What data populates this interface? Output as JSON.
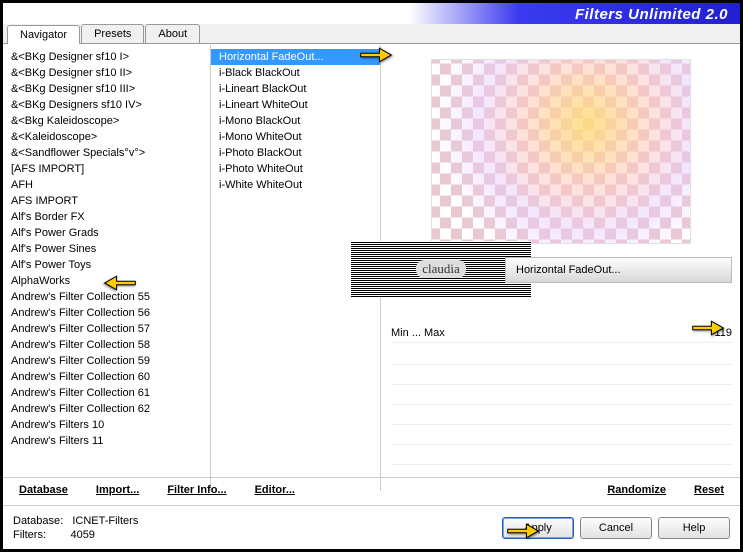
{
  "header": {
    "title": "Filters Unlimited 2.0"
  },
  "tabs": [
    "Navigator",
    "Presets",
    "About"
  ],
  "active_tab": 0,
  "categories": [
    "&<BKg Designer sf10 I>",
    "&<BKg Designer sf10 II>",
    "&<BKg Designer sf10 III>",
    "&<BKg Designers sf10 IV>",
    "&<Bkg Kaleidoscope>",
    "&<Kaleidoscope>",
    "&<Sandflower Specials°v°>",
    "[AFS IMPORT]",
    "AFH",
    "AFS IMPORT",
    "Alf's Border FX",
    "Alf's Power Grads",
    "Alf's Power Sines",
    "Alf's Power Toys",
    "AlphaWorks",
    "Andrew's Filter Collection 55",
    "Andrew's Filter Collection 56",
    "Andrew's Filter Collection 57",
    "Andrew's Filter Collection 58",
    "Andrew's Filter Collection 59",
    "Andrew's Filter Collection 60",
    "Andrew's Filter Collection 61",
    "Andrew's Filter Collection 62",
    "Andrew's Filters 10",
    "Andrew's Filters 11"
  ],
  "filters": [
    "Horizontal FadeOut...",
    "i-Black BlackOut",
    "i-Lineart BlackOut",
    "i-Lineart WhiteOut",
    "i-Mono BlackOut",
    "i-Mono WhiteOut",
    "i-Photo BlackOut",
    "i-Photo WhiteOut",
    "i-White WhiteOut"
  ],
  "selected_filter_index": 0,
  "watermark": "claudia",
  "current_filter_name": "Horizontal FadeOut...",
  "param": {
    "label": "Min ... Max",
    "value": "119"
  },
  "menu": {
    "database": "Database",
    "import": "Import...",
    "filter_info": "Filter Info...",
    "editor": "Editor...",
    "randomize": "Randomize",
    "reset": "Reset"
  },
  "status": {
    "db_label": "Database:",
    "db_value": "ICNET-Filters",
    "filters_label": "Filters:",
    "filters_value": "4059"
  },
  "buttons": {
    "apply": "Apply",
    "cancel": "Cancel",
    "help": "Help"
  }
}
